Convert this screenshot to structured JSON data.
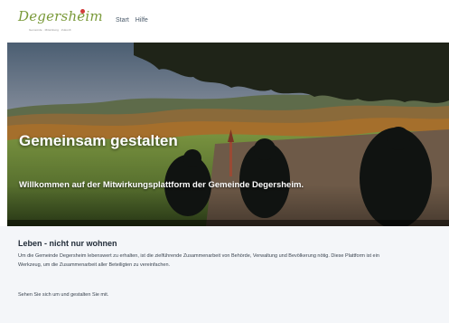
{
  "header": {
    "logo_text": "Degersheim",
    "logo_tagline": "Gemeinde · Mitwirkung · Zukunft",
    "nav": [
      "Start",
      "Hilfe"
    ]
  },
  "hero": {
    "title": "Gemeinsam gestalten",
    "subtitle": "Willkommen auf der Mitwirkungsplattform der Gemeinde Degersheim."
  },
  "section": {
    "title": "Leben - nicht nur wohnen",
    "body": "Um die Gemeinde Degersheim lebenswert zu erhalten, ist die zielführende Zusammenarbeit von Behörde, Verwaltung und Bevölkerung nötig. Diese Plattform ist ein Werkzeug, um die Zusammenarbeit aller Beteiligten zu vereinfachen.",
    "cta": "Sehen Sie sich um und gestalten Sie mit."
  },
  "colors": {
    "logo_green": "#7a9a3a",
    "logo_red_dot": "#d23c3c",
    "content_background": "#f4f6f9"
  }
}
